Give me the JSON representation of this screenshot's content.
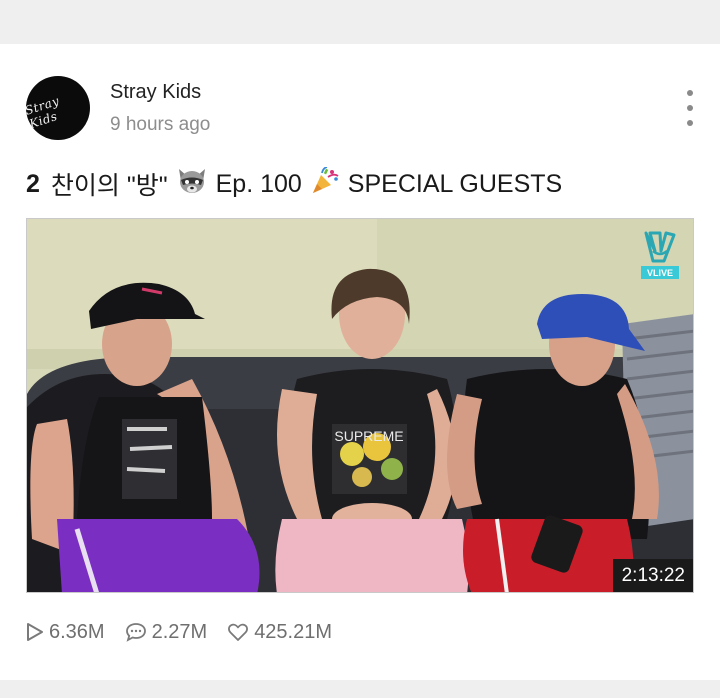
{
  "post": {
    "channel_name": "Stray Kids",
    "avatar_text": "Stray Kids",
    "time_ago": "9 hours ago",
    "title_number": "2",
    "title_text_1": "찬이의 \"방\"",
    "title_text_2": "Ep. 100",
    "title_text_3": "SPECIAL GUESTS",
    "title_emoji_1": "raccoon-emoji",
    "title_emoji_2": "party-popper-emoji"
  },
  "video": {
    "duration": "2:13:22",
    "watermark": "VLIVE",
    "shirt_print": "SUPREME"
  },
  "stats": {
    "plays": "6.36M",
    "comments": "2.27M",
    "likes": "425.21M"
  },
  "icons": [
    "play-icon",
    "comment-icon",
    "heart-icon",
    "more-vertical-icon"
  ],
  "colors": {
    "background": "#efefef",
    "card": "#ffffff",
    "secondary_text": "#8d8d8d",
    "stat_text": "#6f6f6f",
    "vlive_accent": "#3ac9d6"
  }
}
